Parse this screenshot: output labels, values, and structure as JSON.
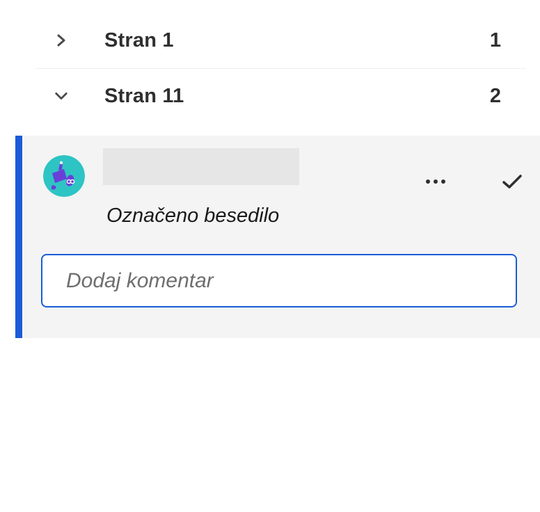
{
  "pages": [
    {
      "label": "Stran 1",
      "count": "1",
      "expanded": false,
      "chevron_icon": "chevron-right-icon"
    },
    {
      "label": "Stran 11",
      "count": "2",
      "expanded": true,
      "chevron_icon": "chevron-down-icon"
    }
  ],
  "comment": {
    "author_name": "",
    "avatar_icon": "user-avatar-icon",
    "more_icon": "more-options-icon",
    "resolve_icon": "checkmark-icon",
    "marked_text": "Označeno besedilo",
    "input": {
      "value": "",
      "placeholder": "Dodaj komentar"
    }
  },
  "colors": {
    "accent": "#1a5cd8",
    "card_background": "#f4f4f4",
    "avatar_background": "#2ec4c4",
    "avatar_figure": "#6a3fd8",
    "text": "#2f2f2f"
  }
}
